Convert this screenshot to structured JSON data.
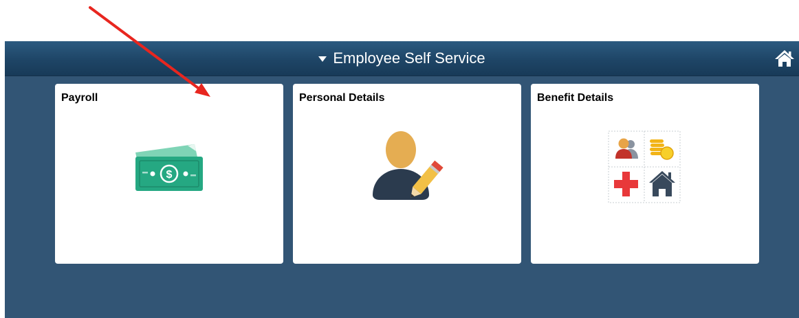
{
  "header": {
    "title": "Employee Self Service"
  },
  "tiles": [
    {
      "label": "Payroll",
      "icon": "money-icon"
    },
    {
      "label": "Personal Details",
      "icon": "person-edit-icon"
    },
    {
      "label": "Benefit Details",
      "icon": "benefits-icon"
    }
  ],
  "colors": {
    "page_background": "#325575",
    "header_bar": "#1e4566",
    "tile_background": "#ffffff",
    "annotation_arrow": "#e8261f"
  }
}
